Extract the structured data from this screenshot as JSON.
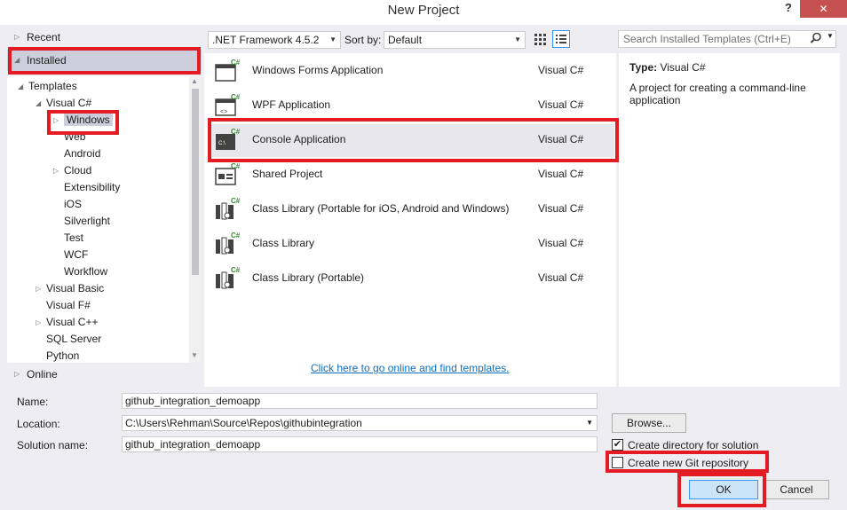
{
  "window": {
    "title": "New Project",
    "help": "?",
    "close": "✕"
  },
  "nav": {
    "recent": "Recent",
    "installed": "Installed",
    "online": "Online"
  },
  "tree": [
    {
      "label": "Templates",
      "level": 0,
      "toggle": "◢"
    },
    {
      "label": "Visual C#",
      "level": 1,
      "toggle": "◢"
    },
    {
      "label": "Windows",
      "level": 2,
      "toggle": "▷",
      "selected": true
    },
    {
      "label": "Web",
      "level": 2,
      "toggle": ""
    },
    {
      "label": "Android",
      "level": 2,
      "toggle": ""
    },
    {
      "label": "Cloud",
      "level": 2,
      "toggle": "▷"
    },
    {
      "label": "Extensibility",
      "level": 2,
      "toggle": ""
    },
    {
      "label": "iOS",
      "level": 2,
      "toggle": ""
    },
    {
      "label": "Silverlight",
      "level": 2,
      "toggle": ""
    },
    {
      "label": "Test",
      "level": 2,
      "toggle": ""
    },
    {
      "label": "WCF",
      "level": 2,
      "toggle": ""
    },
    {
      "label": "Workflow",
      "level": 2,
      "toggle": ""
    },
    {
      "label": "Visual Basic",
      "level": 1,
      "toggle": "▷"
    },
    {
      "label": "Visual F#",
      "level": 1,
      "toggle": ""
    },
    {
      "label": "Visual C++",
      "level": 1,
      "toggle": "▷"
    },
    {
      "label": "SQL Server",
      "level": 1,
      "toggle": ""
    },
    {
      "label": "Python",
      "level": 1,
      "toggle": ""
    }
  ],
  "toolbar": {
    "framework": ".NET Framework 4.5.2",
    "sort_label": "Sort by:",
    "sort_value": "Default",
    "search_placeholder": "Search Installed Templates (Ctrl+E)"
  },
  "templates": [
    {
      "name": "Windows Forms Application",
      "lang": "Visual C#",
      "icon": "winforms-icon"
    },
    {
      "name": "WPF Application",
      "lang": "Visual C#",
      "icon": "wpf-icon"
    },
    {
      "name": "Console Application",
      "lang": "Visual C#",
      "icon": "console-icon",
      "selected": true
    },
    {
      "name": "Shared Project",
      "lang": "Visual C#",
      "icon": "shared-project-icon"
    },
    {
      "name": "Class Library (Portable for iOS, Android and Windows)",
      "lang": "Visual C#",
      "icon": "class-library-icon"
    },
    {
      "name": "Class Library",
      "lang": "Visual C#",
      "icon": "class-library-icon"
    },
    {
      "name": "Class Library (Portable)",
      "lang": "Visual C#",
      "icon": "class-library-icon"
    }
  ],
  "online_link": "Click here to go online and find templates.",
  "description": {
    "type_label": "Type:",
    "type_value": "Visual C#",
    "text": "A project for creating a command-line application"
  },
  "form": {
    "name_label": "Name:",
    "name_value": "github_integration_demoapp",
    "location_label": "Location:",
    "location_value": "C:\\Users\\Rehman\\Source\\Repos\\githubintegration",
    "solution_label": "Solution name:",
    "solution_value": "github_integration_demoapp",
    "browse": "Browse...",
    "create_dir_label": "Create directory for solution",
    "create_dir_checked": true,
    "git_label": "Create new Git repository",
    "git_checked": false,
    "ok": "OK",
    "cancel": "Cancel"
  },
  "colors": {
    "highlight": "#e31c24",
    "accent": "#3399ff",
    "link": "#0e70c0"
  }
}
